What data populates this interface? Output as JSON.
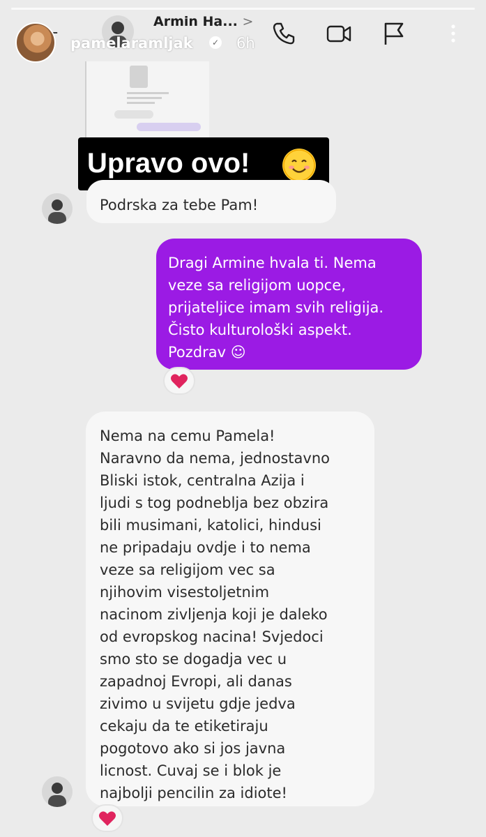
{
  "story": {
    "username": "pamelaramljak",
    "time": "6h",
    "verified_icon": "verified-badge-icon"
  },
  "dm_header": {
    "name": "Armin Ha...",
    "name_chevron": ">",
    "subtitle": "..."
  },
  "sticker": {
    "text": "Upravo ovo!",
    "emoji": "smiling-face-emoji"
  },
  "messages": [
    {
      "direction": "incoming",
      "text": "Podrska za tebe Pam!"
    },
    {
      "direction": "outgoing",
      "text": "Dragi Armine hvala ti. Nema\nveze sa religijom uopce,\nprijateljice imam svih religija.\nČisto kulturološki aspekt.\nPozdrav ☺",
      "reaction": "heart"
    },
    {
      "direction": "incoming",
      "text": "Nema na cemu Pamela!\nNaravno da nema, jednostavno\nBliski istok, centralna Azija i\nljudi s tog podneblja bez obzira\nbili musimani, katolici, hindusi\nne pripadaju ovdje i to nema\nveze sa religijom vec sa\nnjihovim visestoljetnim\nnacinom zivljenja koji je daleko\nod evropskog nacina! Svjedoci\nsmo sto se dogadja vec u\nzapadnoj Evropi, ali danas\nzivimo u svijetu gdje jedva\ncekaju da te etiketiraju\npogotovo ako si jos javna\nlicnost. Cuvaj se i blok je\nnajbolji pencilin za idiote!",
      "reaction": "heart"
    }
  ],
  "colors": {
    "background": "#ebebeb",
    "outgoing_bubble": "#9b1be4",
    "incoming_bubble": "#f7f7f7",
    "sticker_bg": "#000000",
    "heart": "#e0245e"
  }
}
